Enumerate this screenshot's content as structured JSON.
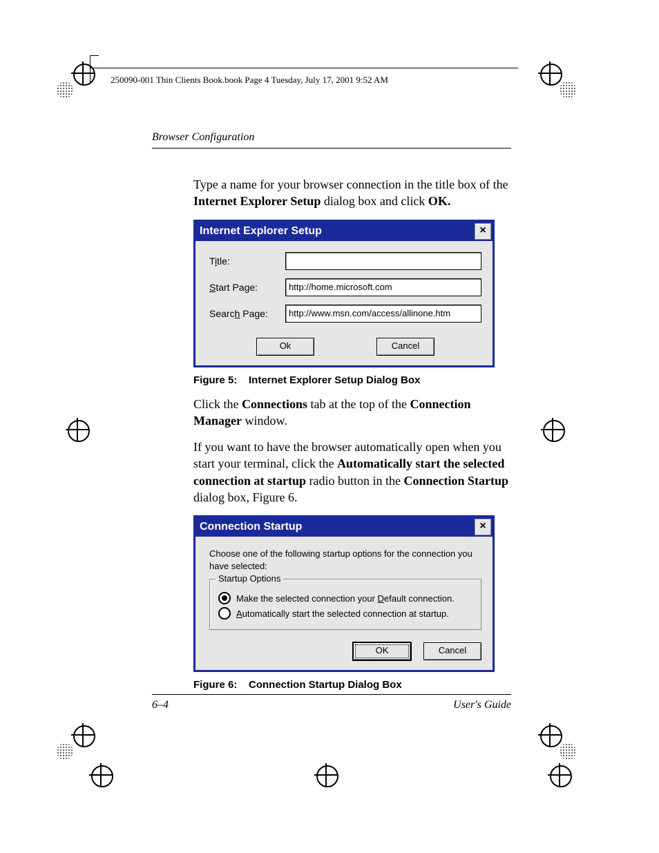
{
  "meta": {
    "crop_info": "250090-001 Thin Clients Book.book  Page 4  Tuesday, July 17, 2001  9:52 AM"
  },
  "header": {
    "section": "Browser Configuration"
  },
  "para1": {
    "pre": "Type a name for your browser connection in the title box of the ",
    "b1": "Internet Explorer Setup",
    "mid": " dialog box and click ",
    "b2": "OK."
  },
  "dialog1": {
    "title": "Internet Explorer Setup",
    "close": "×",
    "labels": {
      "title_pre": "T",
      "title_u": "i",
      "title_post": "tle:",
      "start_pre": "",
      "start_u": "S",
      "start_post": "tart Page:",
      "search_pre": "Searc",
      "search_u": "h",
      "search_post": " Page:"
    },
    "fields": {
      "title": "",
      "start": "http://home.microsoft.com",
      "search": "http://www.msn.com/access/allinone.htm"
    },
    "buttons": {
      "ok": "Ok",
      "cancel": "Cancel"
    }
  },
  "caption1": {
    "label": "Figure 5:",
    "text": "Internet Explorer Setup Dialog Box"
  },
  "para2": {
    "pre": "Click the ",
    "b1": "Connections",
    "mid": " tab at the top of the ",
    "b2": "Connection Manager",
    "post": " window."
  },
  "para3": {
    "l1": "If you want to have the browser automatically open when you start your terminal, click the ",
    "b1": "Automatically start the selected connection at startup",
    "l2": " radio button in the ",
    "b2": "Connection Startup",
    "l3": " dialog box, Figure 6."
  },
  "dialog2": {
    "title": "Connection Startup",
    "close": "×",
    "instruction": "Choose one of the following startup options for the connection you have selected:",
    "group": "Startup Options",
    "radio1": {
      "pre": "Make the selected connection your ",
      "u": "D",
      "post": "efault connection.",
      "selected": true
    },
    "radio2": {
      "pre": "",
      "u": "A",
      "post": "utomatically start the selected connection at startup.",
      "selected": false
    },
    "buttons": {
      "ok": "OK",
      "cancel": "Cancel"
    }
  },
  "caption2": {
    "label": "Figure 6:",
    "text": "Connection Startup Dialog Box"
  },
  "footer": {
    "page": "6–4",
    "doc": "User's Guide"
  }
}
